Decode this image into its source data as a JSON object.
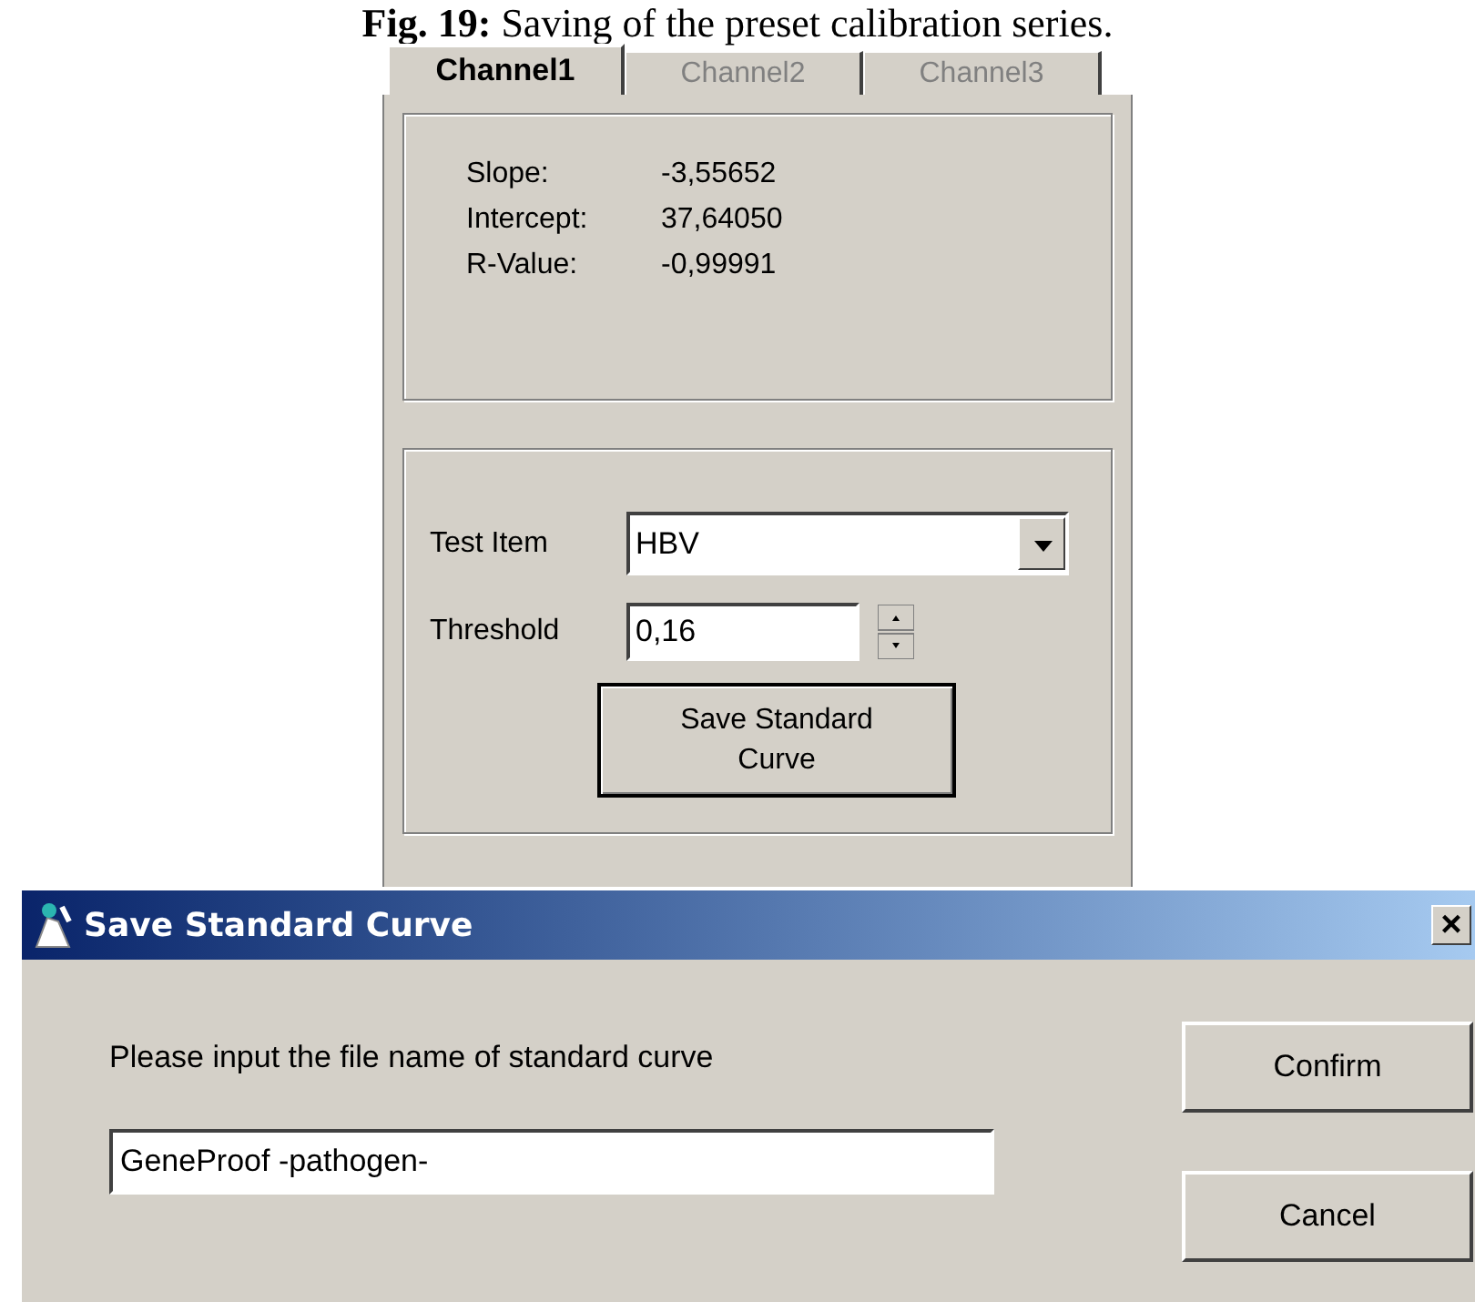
{
  "caption": "**Fig. 19:** Saving of the preset calibration series.",
  "tabs": [
    {
      "label": "Channel1",
      "selected": true
    },
    {
      "label": "Channel2",
      "selected": false
    },
    {
      "label": "Channel3",
      "selected": false
    }
  ],
  "results": [
    {
      "label": "Slope:",
      "value": "-3,55652"
    },
    {
      "label": "Intercept:",
      "value": "37,64050"
    },
    {
      "label": "R-Value:",
      "value": "-0,99991"
    }
  ],
  "test_item": {
    "label": "Test Item",
    "value": "HBV"
  },
  "threshold": {
    "label": "Threshold",
    "value": "0,16"
  },
  "save_button": "Save Standard Curve",
  "dialog": {
    "title": "Save Standard Curve",
    "prompt": "Please input the file name of standard curve",
    "file_name": "GeneProof -pathogen-",
    "close": "×",
    "buttons": [
      "Confirm",
      "Cancel"
    ]
  }
}
